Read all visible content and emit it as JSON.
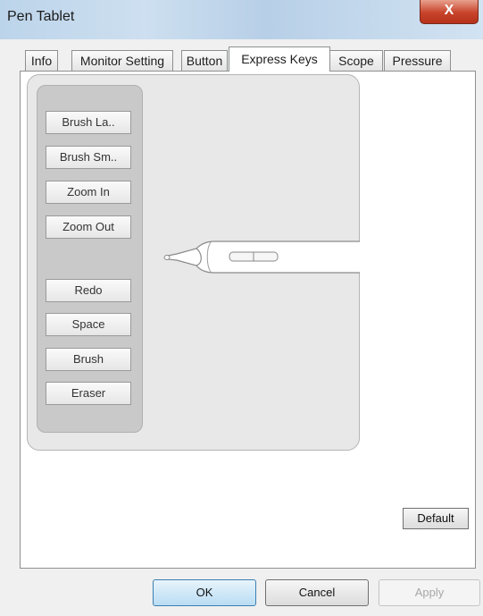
{
  "window": {
    "title": "Pen Tablet",
    "close_glyph": "X"
  },
  "tabs": [
    {
      "label": "Info",
      "active": false
    },
    {
      "label": "Monitor Setting",
      "active": false
    },
    {
      "label": "Button",
      "active": false
    },
    {
      "label": "Express Keys",
      "active": true
    },
    {
      "label": "Scope",
      "active": false
    },
    {
      "label": "Pressure",
      "active": false
    }
  ],
  "express_keys": [
    "Brush La..",
    "Brush Sm..",
    "Zoom In",
    "Zoom Out",
    "Redo",
    "Space",
    "Brush",
    "Eraser"
  ],
  "default_button": "Default",
  "footer": {
    "ok": "OK",
    "cancel": "Cancel",
    "apply": "Apply"
  }
}
